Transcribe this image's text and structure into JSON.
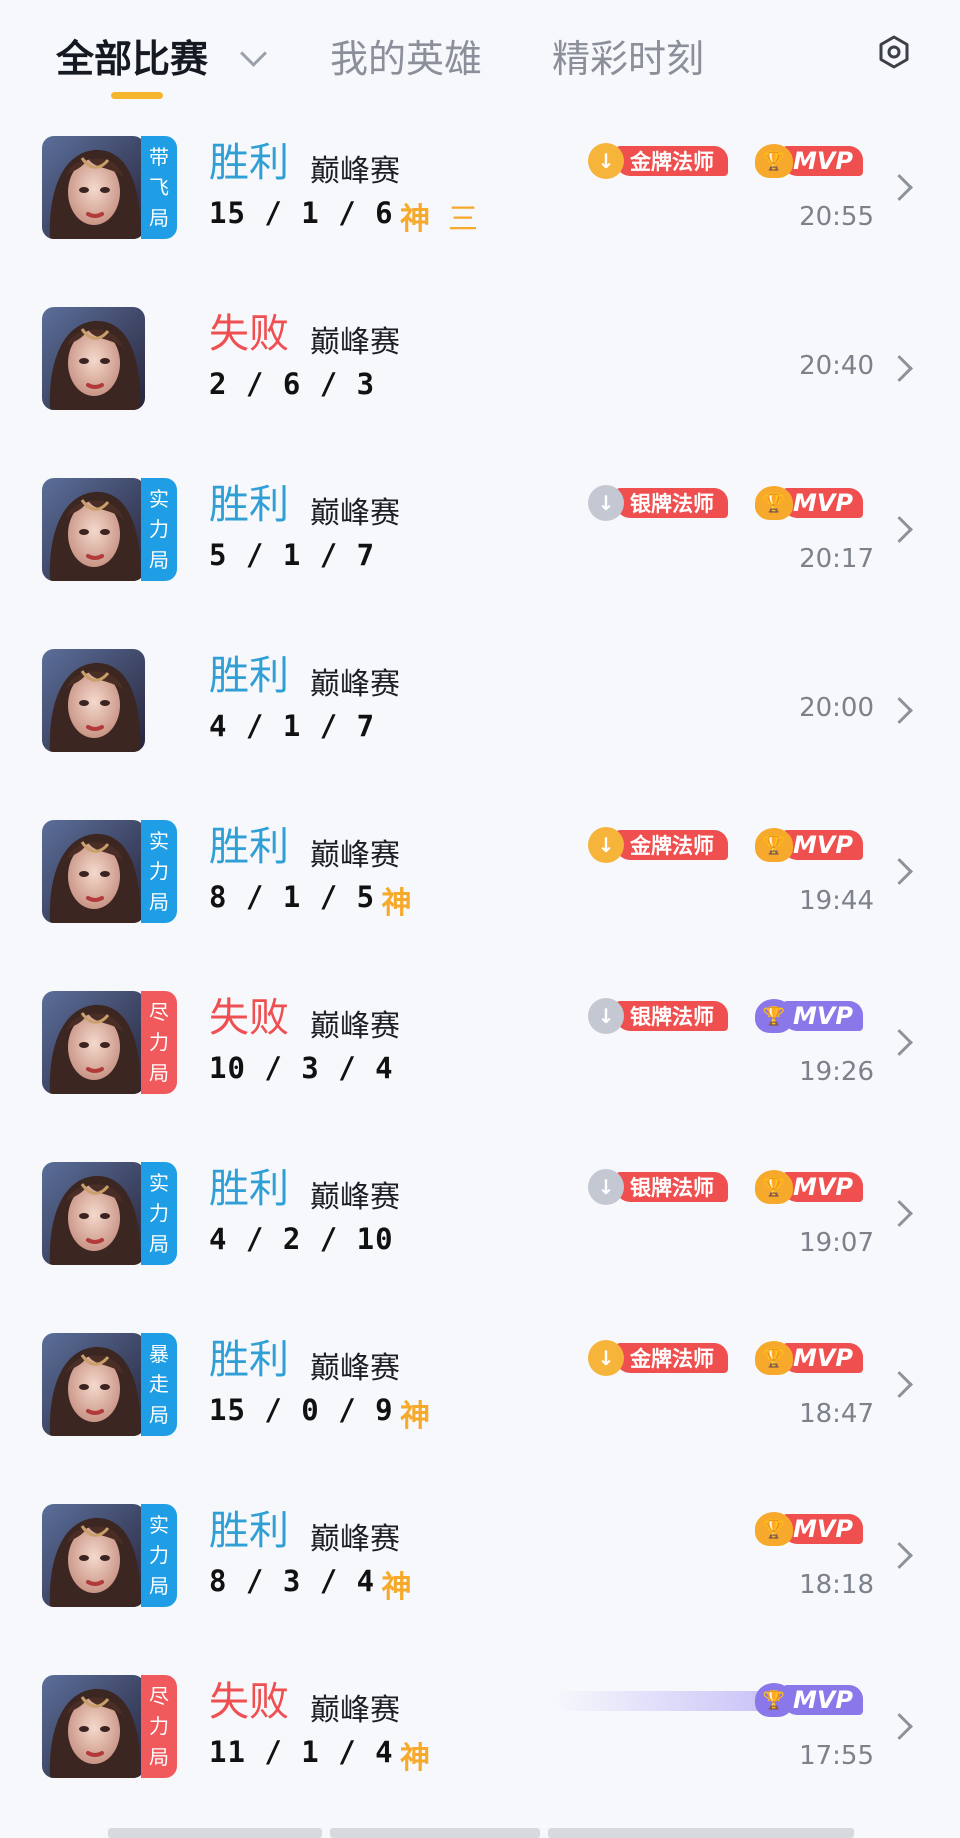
{
  "tabs": {
    "all_matches": "全部比赛",
    "my_heroes": "我的英雄",
    "highlights": "精彩时刻"
  },
  "colors": {
    "win": "#2f9fd6",
    "loss": "#ef4f50",
    "tag_blue": "#1f9ee6",
    "tag_red": "#f05a5d",
    "gold": "#f6a92b",
    "medal_gold_label": "#ef4f4f",
    "medal_silver_circle": "#c3c8d2",
    "mvp_gold": "#f6a92b",
    "mvp_purple": "#8a78ea"
  },
  "matches": [
    {
      "hero_icon": "hero-portrait",
      "tag": [
        "带",
        "飞",
        "局"
      ],
      "tag_color": "blue",
      "result": "胜利",
      "outcome": "win",
      "mode": "巅峰赛",
      "kda": "15 / 1 / 6",
      "god": "神",
      "triple": "三",
      "medal": "金牌法师",
      "medal_tier": "gold",
      "mvp": "MVP",
      "mvp_tier": "gold",
      "time": "20:55"
    },
    {
      "hero_icon": "hero-portrait",
      "tag": null,
      "tag_color": null,
      "result": "失败",
      "outcome": "loss",
      "mode": "巅峰赛",
      "kda": "2 / 6 / 3",
      "god": null,
      "triple": null,
      "medal": null,
      "medal_tier": null,
      "mvp": null,
      "mvp_tier": null,
      "time": "20:40"
    },
    {
      "hero_icon": "hero-portrait",
      "tag": [
        "实",
        "力",
        "局"
      ],
      "tag_color": "blue",
      "result": "胜利",
      "outcome": "win",
      "mode": "巅峰赛",
      "kda": "5 / 1 / 7",
      "god": null,
      "triple": null,
      "medal": "银牌法师",
      "medal_tier": "silver",
      "mvp": "MVP",
      "mvp_tier": "gold",
      "time": "20:17"
    },
    {
      "hero_icon": "hero-portrait",
      "tag": null,
      "tag_color": null,
      "result": "胜利",
      "outcome": "win",
      "mode": "巅峰赛",
      "kda": "4 / 1 / 7",
      "god": null,
      "triple": null,
      "medal": null,
      "medal_tier": null,
      "mvp": null,
      "mvp_tier": null,
      "time": "20:00"
    },
    {
      "hero_icon": "hero-portrait",
      "tag": [
        "实",
        "力",
        "局"
      ],
      "tag_color": "blue",
      "result": "胜利",
      "outcome": "win",
      "mode": "巅峰赛",
      "kda": "8 / 1 / 5",
      "god": "神",
      "triple": null,
      "medal": "金牌法师",
      "medal_tier": "gold",
      "mvp": "MVP",
      "mvp_tier": "gold",
      "time": "19:44"
    },
    {
      "hero_icon": "hero-portrait",
      "tag": [
        "尽",
        "力",
        "局"
      ],
      "tag_color": "red",
      "result": "失败",
      "outcome": "loss",
      "mode": "巅峰赛",
      "kda": "10 / 3 / 4",
      "god": null,
      "triple": null,
      "medal": "银牌法师",
      "medal_tier": "silver",
      "mvp": "MVP",
      "mvp_tier": "purple",
      "time": "19:26"
    },
    {
      "hero_icon": "hero-portrait",
      "tag": [
        "实",
        "力",
        "局"
      ],
      "tag_color": "blue",
      "result": "胜利",
      "outcome": "win",
      "mode": "巅峰赛",
      "kda": "4 / 2 / 10",
      "god": null,
      "triple": null,
      "medal": "银牌法师",
      "medal_tier": "silver",
      "mvp": "MVP",
      "mvp_tier": "gold",
      "time": "19:07"
    },
    {
      "hero_icon": "hero-portrait",
      "tag": [
        "暴",
        "走",
        "局"
      ],
      "tag_color": "blue",
      "result": "胜利",
      "outcome": "win",
      "mode": "巅峰赛",
      "kda": "15 / 0 / 9",
      "god": "神",
      "triple": null,
      "medal": "金牌法师",
      "medal_tier": "gold",
      "mvp": "MVP",
      "mvp_tier": "gold",
      "time": "18:47"
    },
    {
      "hero_icon": "hero-portrait",
      "tag": [
        "实",
        "力",
        "局"
      ],
      "tag_color": "blue",
      "result": "胜利",
      "outcome": "win",
      "mode": "巅峰赛",
      "kda": "8 / 3 / 4",
      "god": "神",
      "triple": null,
      "medal": null,
      "medal_tier": null,
      "mvp": "MVP",
      "mvp_tier": "gold",
      "time": "18:18"
    },
    {
      "hero_icon": "hero-portrait",
      "tag": [
        "尽",
        "力",
        "局"
      ],
      "tag_color": "red",
      "result": "失败",
      "outcome": "loss",
      "mode": "巅峰赛",
      "kda": "11 / 1 / 4",
      "god": "神",
      "triple": null,
      "medal": null,
      "medal_tier": null,
      "mvp": "MVP",
      "mvp_tier": "purple-streak",
      "time": "17:55"
    }
  ]
}
